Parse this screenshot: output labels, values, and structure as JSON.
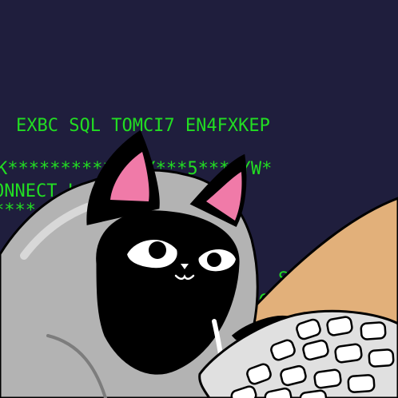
{
  "screen": {
    "background": "#1f1e3d",
    "text_color": "#22dd22",
    "lines": [
      "EXBC SQL TOMCI7 EN4FXKEP",
      "K*************X***5****YW*",
      "ONNECT              LABASE *",
      "****                 UH*****",
      "SE",
      "SC"
    ]
  },
  "character": {
    "name": "black-cat-in-grey-hoodie",
    "hood_color": "#b3b3b3",
    "face_color": "#000000",
    "ear_inner_color": "#f07aa8"
  },
  "desk": {
    "color": "#e2b07a"
  },
  "keyboard": {
    "color": "#e0e0e0",
    "key_color": "#ffffff"
  }
}
